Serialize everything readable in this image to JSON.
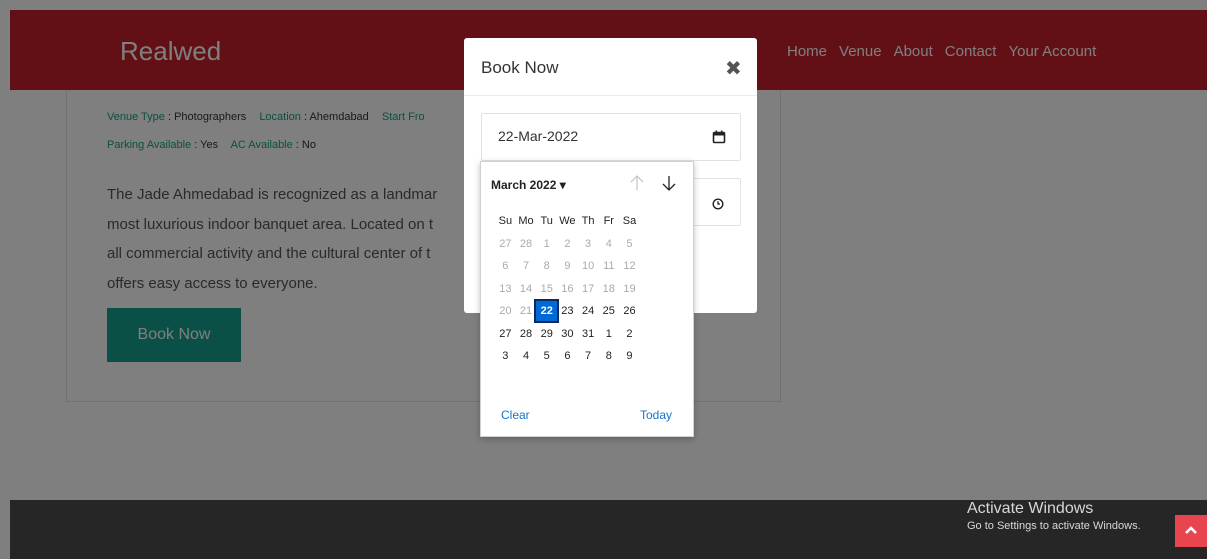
{
  "navbar": {
    "brand": "Realwed",
    "links": [
      "Home",
      "Venue",
      "About",
      "Contact",
      "Your Account"
    ]
  },
  "venue": {
    "type_label": "Venue Type",
    "type_value": "Photographers",
    "location_label": "Location",
    "location_value": "Ahemdabad",
    "start_label": "Start Fro",
    "parking_label": "Parking Available",
    "parking_value": "Yes",
    "ac_label": "AC Available",
    "ac_value": "No",
    "description_lines": [
      "The Jade Ahmedabad is recognized as a landmar",
      "most luxurious indoor banquet area. Located on t",
      "all commercial activity and the cultural center of t",
      "offers easy access to everyone."
    ],
    "book_button": "Book Now"
  },
  "modal": {
    "title": "Book Now",
    "close_glyph": "✖",
    "date_value": "22-Mar-2022"
  },
  "calendar": {
    "month_label": "March 2022 ▾",
    "weekdays": [
      "Su",
      "Mo",
      "Tu",
      "We",
      "Th",
      "Fr",
      "Sa"
    ],
    "weeks": [
      [
        "27",
        "28",
        "1",
        "2",
        "3",
        "4",
        "5"
      ],
      [
        "6",
        "7",
        "8",
        "9",
        "10",
        "11",
        "12"
      ],
      [
        "13",
        "14",
        "15",
        "16",
        "17",
        "18",
        "19"
      ],
      [
        "20",
        "21",
        "22",
        "23",
        "24",
        "25",
        "26"
      ],
      [
        "27",
        "28",
        "29",
        "30",
        "31",
        "1",
        "2"
      ],
      [
        "3",
        "4",
        "5",
        "6",
        "7",
        "8",
        "9"
      ]
    ],
    "selected_day": "22",
    "clear_label": "Clear",
    "today_label": "Today"
  },
  "watermark": {
    "title": "Activate Windows",
    "subtitle": "Go to Settings to activate Windows."
  },
  "colors": {
    "navbar": "#c4202b",
    "accent": "#16a08c",
    "selected": "#0069d9"
  }
}
